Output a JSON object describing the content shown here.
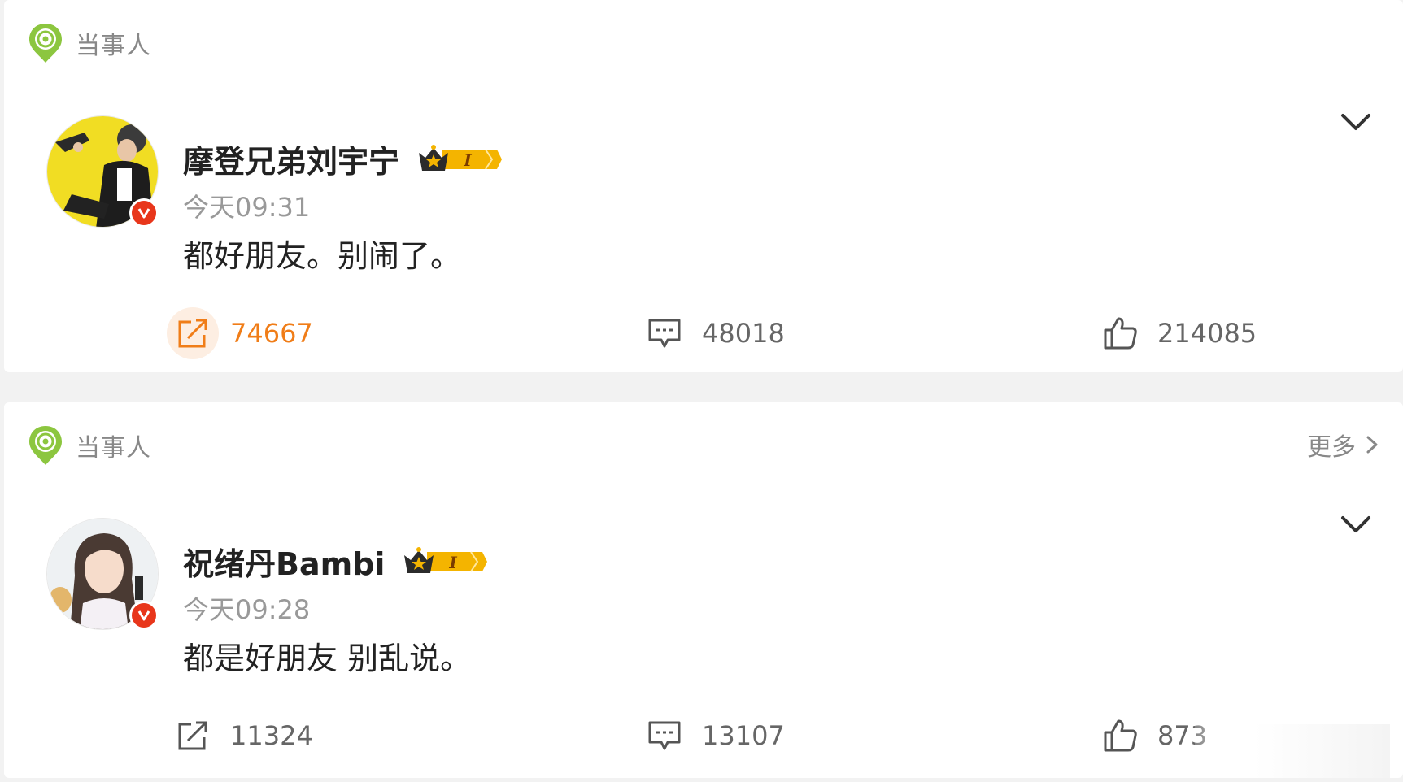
{
  "posts": [
    {
      "section_label": "当事人",
      "more_label": "",
      "username": "摩登兄弟刘宇宁",
      "level": "I",
      "time": "今天09:31",
      "text": "都好朋友。别闹了。",
      "reposts": "74667",
      "comments": "48018",
      "likes": "214085",
      "repost_active": true,
      "avatar": "yellow-background-portrait"
    },
    {
      "section_label": "当事人",
      "more_label": "更多",
      "username": "祝绪丹Bambi",
      "level": "I",
      "time": "今天09:28",
      "text": "都是好朋友 别乱说。",
      "reposts": "11324",
      "comments": "13107",
      "likes": "873",
      "repost_active": false,
      "avatar": "light-background-portrait"
    }
  ],
  "icons": {
    "section": "location-pin-icon",
    "verified": "verified-v-badge",
    "level": "crown-level-badge",
    "collapse": "chevron-down-icon",
    "more": "chevron-right-icon",
    "repost": "share-arrow-icon",
    "comment": "comment-bubble-icon",
    "like": "thumbs-up-icon"
  },
  "colors": {
    "accent": "#f07d18",
    "section_icon": "#8cc63f",
    "verified": "#e8361b",
    "level_badge": "#f4b400"
  }
}
